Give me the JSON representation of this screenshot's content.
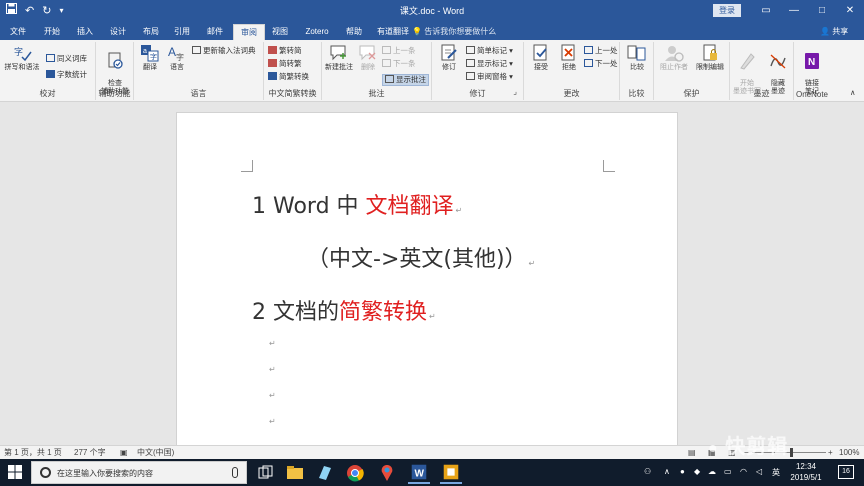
{
  "titlebar": {
    "save_icon": "save-icon",
    "undo_icon": "undo-icon",
    "redo_icon": "redo-icon",
    "customize_icon": "customize-icon",
    "title": "课文.doc - Word",
    "login_label": "登录",
    "window_controls": [
      "—",
      "□",
      "✕"
    ]
  },
  "tabs": [
    "文件",
    "开始",
    "插入",
    "设计",
    "布局",
    "引用",
    "邮件",
    "审阅",
    "视图",
    "Zotero",
    "帮助",
    "有道翻译"
  ],
  "active_tab": "审阅",
  "tell_me": "告诉我你想要做什么",
  "share_label": "共享",
  "ribbon": {
    "proofing": {
      "label": "校对",
      "spelling": "拼写和语法",
      "thesaurus": "同义词库",
      "word_count": "字数统计"
    },
    "accessibility": {
      "label": "辅助功能",
      "check": "检查\n辅助功能"
    },
    "language": {
      "label": "语言",
      "translate": "翻译",
      "language": "语言",
      "update_ime": "更新输入法词典"
    },
    "chinese_conversion": {
      "label": "中文简繁转换",
      "to_simplified": "繁转简",
      "to_traditional": "简转繁",
      "convert": "简繁转换"
    },
    "comments": {
      "label": "批注",
      "new": "新建批注",
      "delete": "删除",
      "previous": "上一条",
      "next": "下一条",
      "show": "显示批注"
    },
    "tracking": {
      "label": "修订",
      "track": "修订",
      "simple_markup": "简单标记",
      "show_markup": "显示标记",
      "reviewing_pane": "审阅窗格"
    },
    "changes": {
      "label": "更改",
      "accept": "接受",
      "reject": "拒绝",
      "previous": "上一处",
      "next": "下一处"
    },
    "compare": {
      "label": "比较",
      "compare": "比较"
    },
    "protect": {
      "label": "保护",
      "block_authors": "阻止作者",
      "restrict": "限制编辑"
    },
    "ink": {
      "label": "墨迹",
      "start_inking": "开始\n墨迹书写",
      "hide_ink": "隐藏\n墨迹"
    },
    "onenote": {
      "label": "OneNote",
      "linked_notes": "链接\n笔记"
    }
  },
  "document": {
    "line1_prefix": "1 Word 中 ",
    "line1_red": "文档翻译",
    "line2": "（中文->英文(其他)）",
    "line3_prefix": "2  文档的",
    "line3_red": "简繁转换",
    "para_mark": "↵",
    "accent_color": "#e02020"
  },
  "statusbar": {
    "page": "第 1 页，共 1 页",
    "words": "277 个字",
    "proof_icon": "proofing-icon",
    "language": "中文(中国)",
    "zoom": "100%"
  },
  "watermark": "快剪辑",
  "taskbar": {
    "search_placeholder": "在这里输入你要搜索的内容",
    "ime": "英",
    "time": "12:34",
    "date": "2019/5/1",
    "notifications": "16"
  }
}
